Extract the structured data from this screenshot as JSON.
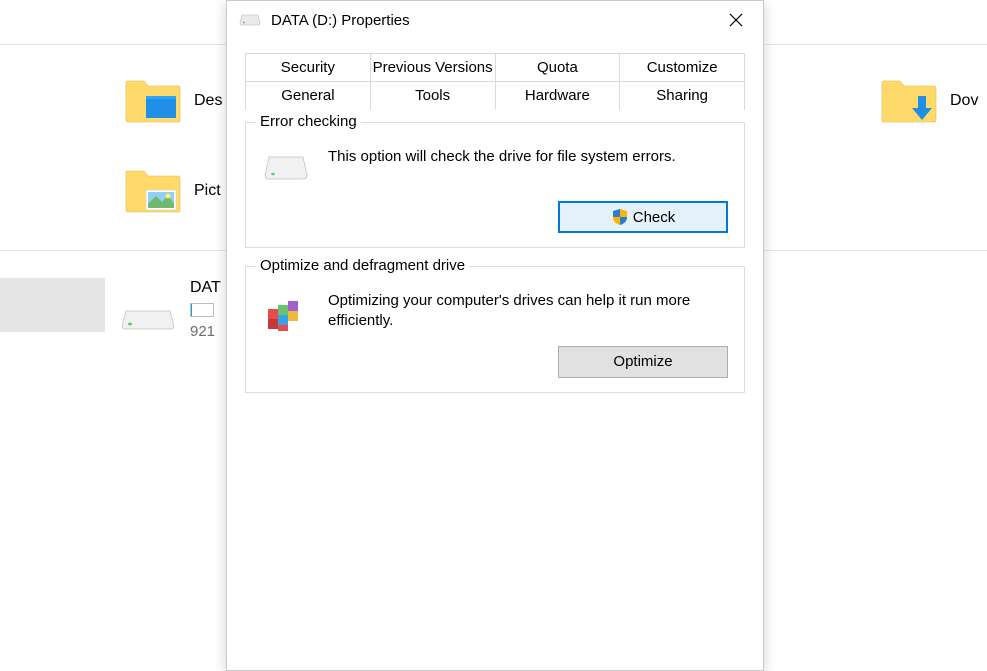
{
  "background": {
    "folders": [
      {
        "label": "Des",
        "inset": "desktop"
      },
      {
        "label": "Pict",
        "inset": "pictures"
      },
      {
        "label": "Dov",
        "inset": "download"
      }
    ],
    "drive": {
      "label": "DAT",
      "size": "921"
    }
  },
  "dialog": {
    "title": "DATA (D:) Properties",
    "close_label": "Close",
    "tabs": {
      "row1": [
        "Security",
        "Previous Versions",
        "Quota",
        "Customize"
      ],
      "row2": [
        "General",
        "Tools",
        "Hardware",
        "Sharing"
      ],
      "active": "Tools"
    },
    "groups": {
      "error_checking": {
        "title": "Error checking",
        "text": "This option will check the drive for file system errors.",
        "button": "Check"
      },
      "optimize": {
        "title": "Optimize and defragment drive",
        "text": "Optimizing your computer's drives can help it run more efficiently.",
        "button": "Optimize"
      }
    }
  }
}
